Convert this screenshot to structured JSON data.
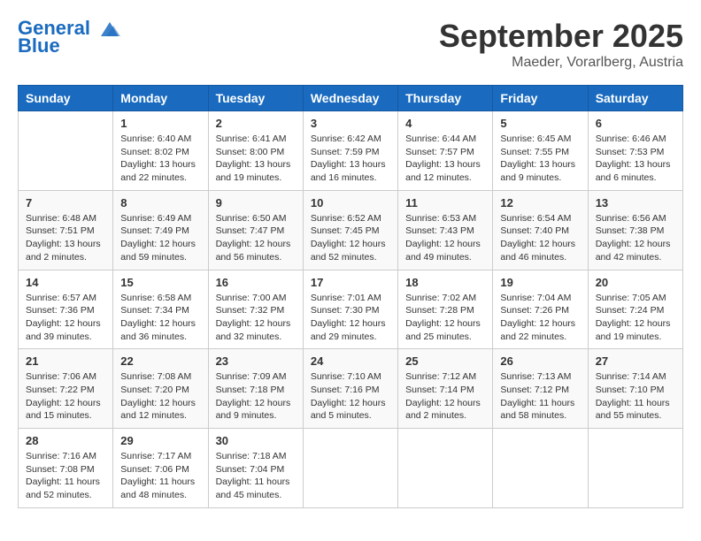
{
  "header": {
    "logo_line1": "General",
    "logo_line2": "Blue",
    "month": "September 2025",
    "location": "Maeder, Vorarlberg, Austria"
  },
  "days_of_week": [
    "Sunday",
    "Monday",
    "Tuesday",
    "Wednesday",
    "Thursday",
    "Friday",
    "Saturday"
  ],
  "weeks": [
    [
      {
        "day": "",
        "info": ""
      },
      {
        "day": "1",
        "info": "Sunrise: 6:40 AM\nSunset: 8:02 PM\nDaylight: 13 hours\nand 22 minutes."
      },
      {
        "day": "2",
        "info": "Sunrise: 6:41 AM\nSunset: 8:00 PM\nDaylight: 13 hours\nand 19 minutes."
      },
      {
        "day": "3",
        "info": "Sunrise: 6:42 AM\nSunset: 7:59 PM\nDaylight: 13 hours\nand 16 minutes."
      },
      {
        "day": "4",
        "info": "Sunrise: 6:44 AM\nSunset: 7:57 PM\nDaylight: 13 hours\nand 12 minutes."
      },
      {
        "day": "5",
        "info": "Sunrise: 6:45 AM\nSunset: 7:55 PM\nDaylight: 13 hours\nand 9 minutes."
      },
      {
        "day": "6",
        "info": "Sunrise: 6:46 AM\nSunset: 7:53 PM\nDaylight: 13 hours\nand 6 minutes."
      }
    ],
    [
      {
        "day": "7",
        "info": "Sunrise: 6:48 AM\nSunset: 7:51 PM\nDaylight: 13 hours\nand 2 minutes."
      },
      {
        "day": "8",
        "info": "Sunrise: 6:49 AM\nSunset: 7:49 PM\nDaylight: 12 hours\nand 59 minutes."
      },
      {
        "day": "9",
        "info": "Sunrise: 6:50 AM\nSunset: 7:47 PM\nDaylight: 12 hours\nand 56 minutes."
      },
      {
        "day": "10",
        "info": "Sunrise: 6:52 AM\nSunset: 7:45 PM\nDaylight: 12 hours\nand 52 minutes."
      },
      {
        "day": "11",
        "info": "Sunrise: 6:53 AM\nSunset: 7:43 PM\nDaylight: 12 hours\nand 49 minutes."
      },
      {
        "day": "12",
        "info": "Sunrise: 6:54 AM\nSunset: 7:40 PM\nDaylight: 12 hours\nand 46 minutes."
      },
      {
        "day": "13",
        "info": "Sunrise: 6:56 AM\nSunset: 7:38 PM\nDaylight: 12 hours\nand 42 minutes."
      }
    ],
    [
      {
        "day": "14",
        "info": "Sunrise: 6:57 AM\nSunset: 7:36 PM\nDaylight: 12 hours\nand 39 minutes."
      },
      {
        "day": "15",
        "info": "Sunrise: 6:58 AM\nSunset: 7:34 PM\nDaylight: 12 hours\nand 36 minutes."
      },
      {
        "day": "16",
        "info": "Sunrise: 7:00 AM\nSunset: 7:32 PM\nDaylight: 12 hours\nand 32 minutes."
      },
      {
        "day": "17",
        "info": "Sunrise: 7:01 AM\nSunset: 7:30 PM\nDaylight: 12 hours\nand 29 minutes."
      },
      {
        "day": "18",
        "info": "Sunrise: 7:02 AM\nSunset: 7:28 PM\nDaylight: 12 hours\nand 25 minutes."
      },
      {
        "day": "19",
        "info": "Sunrise: 7:04 AM\nSunset: 7:26 PM\nDaylight: 12 hours\nand 22 minutes."
      },
      {
        "day": "20",
        "info": "Sunrise: 7:05 AM\nSunset: 7:24 PM\nDaylight: 12 hours\nand 19 minutes."
      }
    ],
    [
      {
        "day": "21",
        "info": "Sunrise: 7:06 AM\nSunset: 7:22 PM\nDaylight: 12 hours\nand 15 minutes."
      },
      {
        "day": "22",
        "info": "Sunrise: 7:08 AM\nSunset: 7:20 PM\nDaylight: 12 hours\nand 12 minutes."
      },
      {
        "day": "23",
        "info": "Sunrise: 7:09 AM\nSunset: 7:18 PM\nDaylight: 12 hours\nand 9 minutes."
      },
      {
        "day": "24",
        "info": "Sunrise: 7:10 AM\nSunset: 7:16 PM\nDaylight: 12 hours\nand 5 minutes."
      },
      {
        "day": "25",
        "info": "Sunrise: 7:12 AM\nSunset: 7:14 PM\nDaylight: 12 hours\nand 2 minutes."
      },
      {
        "day": "26",
        "info": "Sunrise: 7:13 AM\nSunset: 7:12 PM\nDaylight: 11 hours\nand 58 minutes."
      },
      {
        "day": "27",
        "info": "Sunrise: 7:14 AM\nSunset: 7:10 PM\nDaylight: 11 hours\nand 55 minutes."
      }
    ],
    [
      {
        "day": "28",
        "info": "Sunrise: 7:16 AM\nSunset: 7:08 PM\nDaylight: 11 hours\nand 52 minutes."
      },
      {
        "day": "29",
        "info": "Sunrise: 7:17 AM\nSunset: 7:06 PM\nDaylight: 11 hours\nand 48 minutes."
      },
      {
        "day": "30",
        "info": "Sunrise: 7:18 AM\nSunset: 7:04 PM\nDaylight: 11 hours\nand 45 minutes."
      },
      {
        "day": "",
        "info": ""
      },
      {
        "day": "",
        "info": ""
      },
      {
        "day": "",
        "info": ""
      },
      {
        "day": "",
        "info": ""
      }
    ]
  ]
}
